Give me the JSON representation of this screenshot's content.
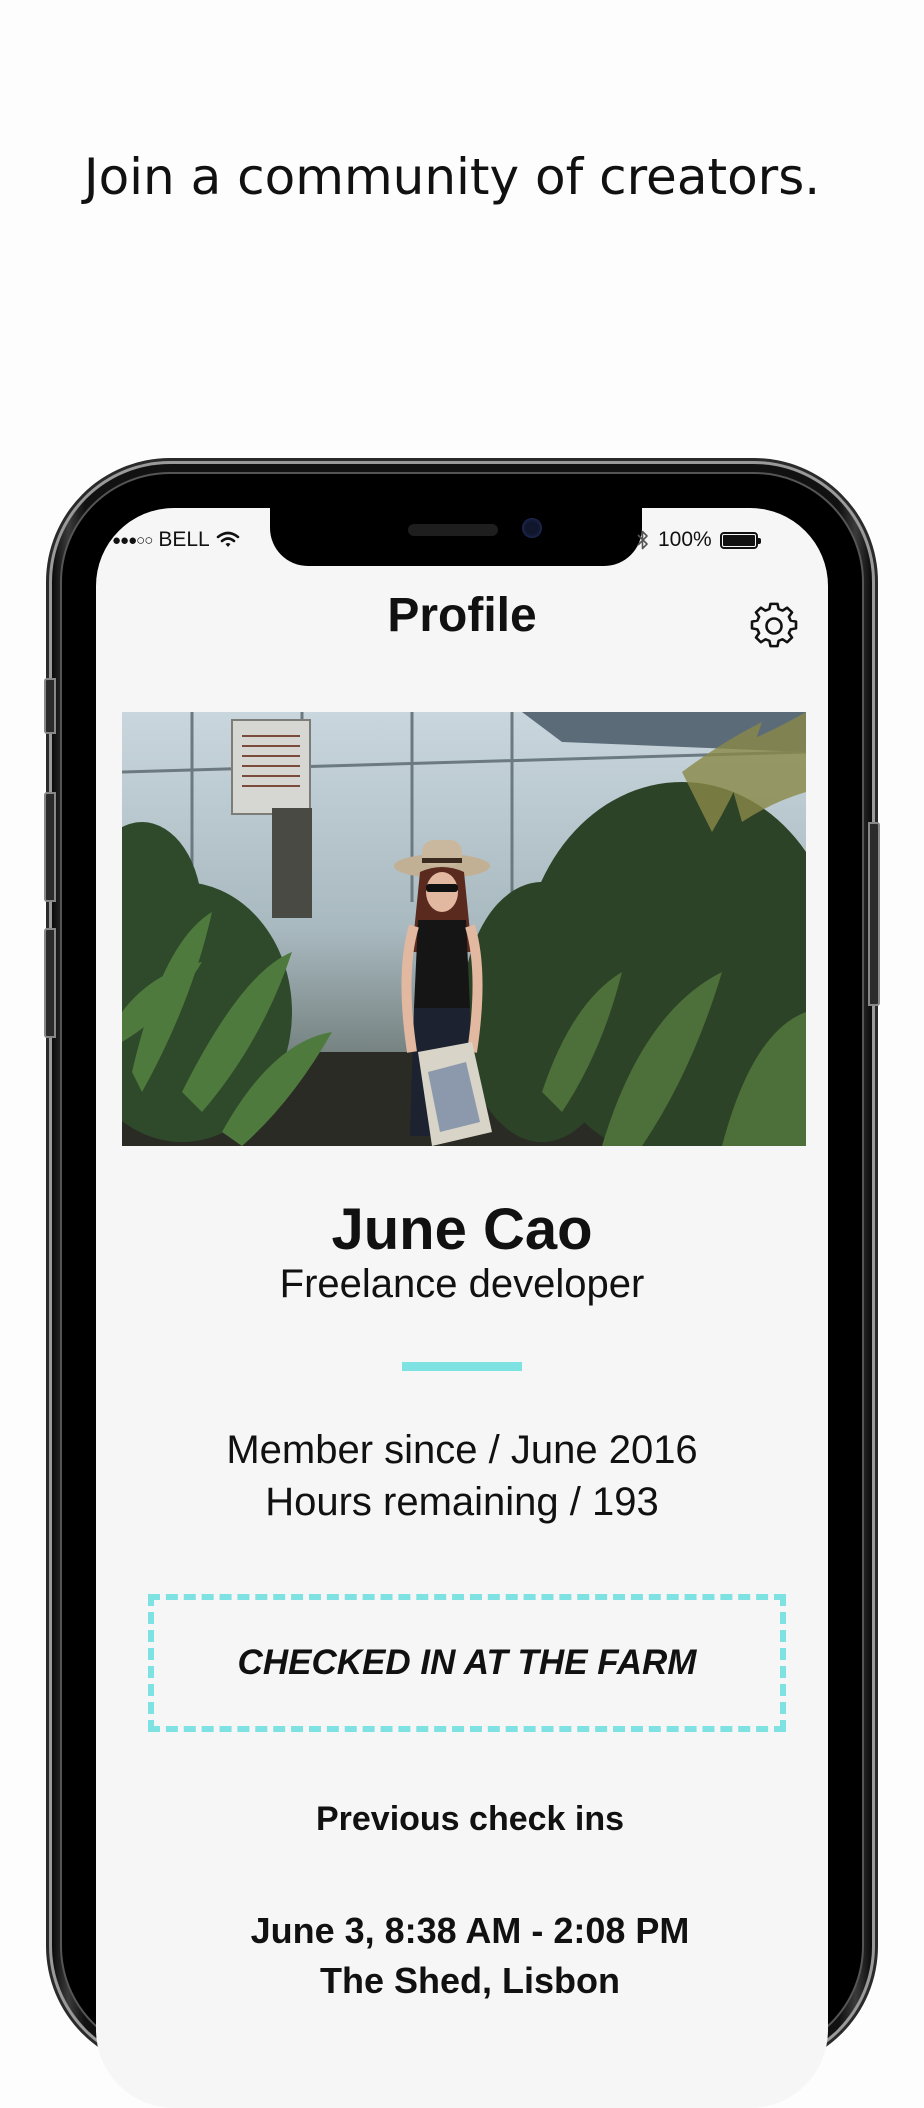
{
  "tagline": "Join a community of creators.",
  "status_bar": {
    "signal": "●●●○○",
    "carrier": "BELL",
    "battery_percent": "100%",
    "battery_level": 1.0
  },
  "header": {
    "title": "Profile",
    "settings_icon": "gear-icon"
  },
  "profile": {
    "photo_alt": "profile photo",
    "name": "June Cao",
    "role": "Freelance developer",
    "member_since": "Member since / June 2016",
    "hours_remaining": "Hours remaining / 193"
  },
  "checkin": {
    "label": "CHECKED IN AT THE FARM"
  },
  "previous": {
    "title": "Previous check ins",
    "items": [
      {
        "time": "June 3, 8:38 AM - 2:08 PM",
        "place": "The Shed, Lisbon"
      }
    ]
  },
  "colors": {
    "accent": "#7ee1e2",
    "screen_bg": "#f6f6f7",
    "text": "#111111"
  }
}
